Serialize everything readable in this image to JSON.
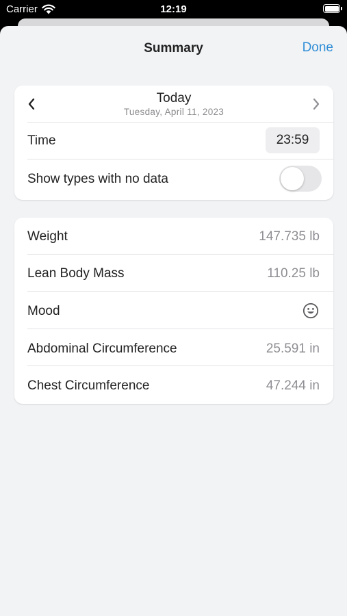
{
  "status_bar": {
    "carrier": "Carrier",
    "time": "12:19",
    "battery_level": 1.0
  },
  "nav": {
    "title": "Summary",
    "done_label": "Done"
  },
  "date_selector": {
    "title": "Today",
    "subtitle": "Tuesday, April 11, 2023",
    "prev_icon": "chevron-left-icon",
    "next_icon": "chevron-right-icon"
  },
  "settings": {
    "time_label": "Time",
    "time_value": "23:59",
    "show_empty_label": "Show types with no data",
    "show_empty_enabled": false
  },
  "measurements": [
    {
      "label": "Weight",
      "value": "147.735 lb"
    },
    {
      "label": "Lean Body Mass",
      "value": "110.25 lb"
    },
    {
      "label": "Mood",
      "icon": "smiley-face-icon"
    },
    {
      "label": "Abdominal Circumference",
      "value": "25.591 in"
    },
    {
      "label": "Chest Circumference",
      "value": "47.244 in"
    }
  ],
  "colors": {
    "accent": "#2f8ed6",
    "background": "#f2f3f5",
    "secondary_text": "#8e8e93"
  }
}
